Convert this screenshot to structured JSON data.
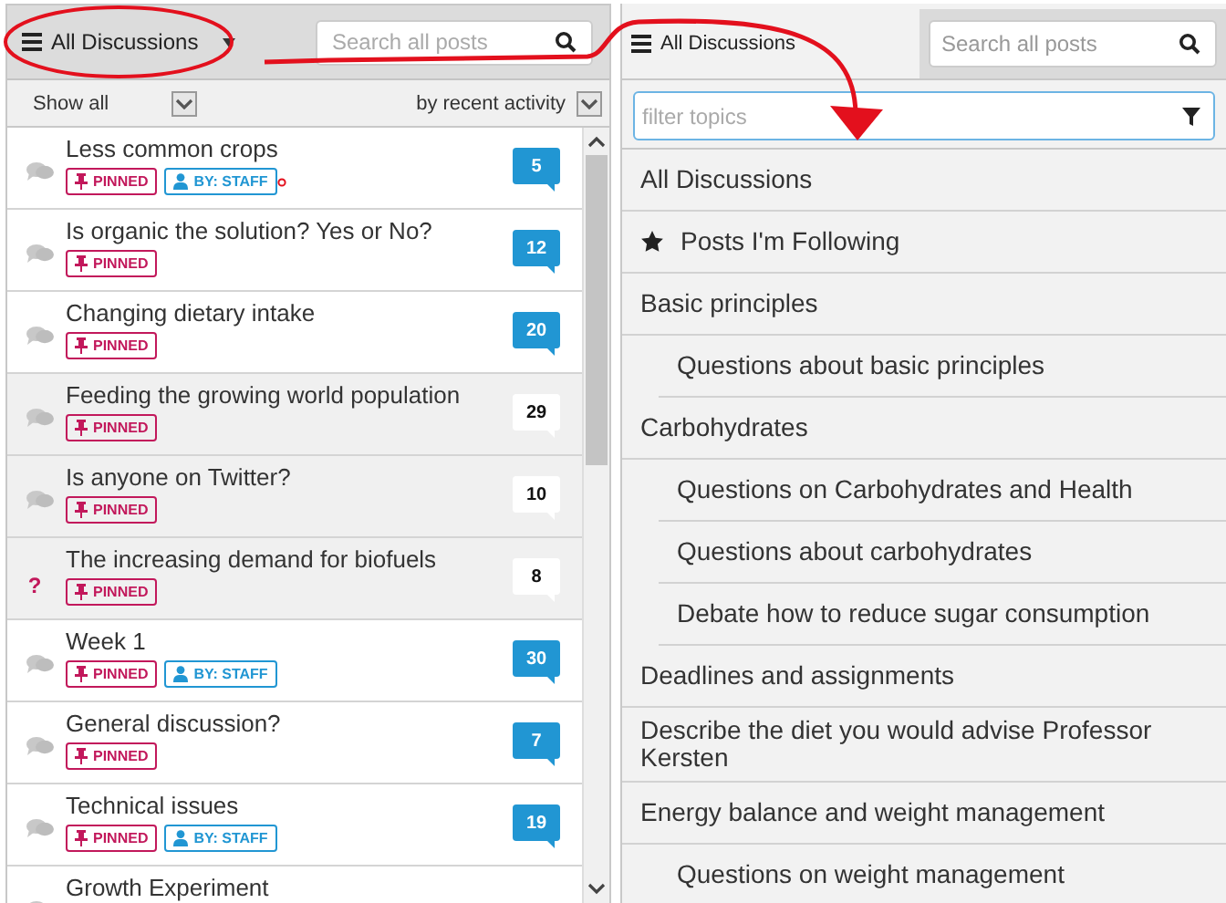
{
  "left_panel": {
    "topic_button": "All Discussions",
    "search": {
      "placeholder": "Search all posts"
    },
    "filter": "Show all",
    "sort": "by recent activity",
    "threads": [
      {
        "kind": "discussion",
        "title": "Less common crops",
        "tags": [
          {
            "kind": "pinned",
            "label": "PINNED"
          },
          {
            "kind": "staff",
            "label": "BY: STAFF"
          }
        ],
        "count": "5",
        "read": false
      },
      {
        "kind": "discussion",
        "title": "Is organic the solution? Yes or No?",
        "tags": [
          {
            "kind": "pinned",
            "label": "PINNED"
          }
        ],
        "count": "12",
        "read": false
      },
      {
        "kind": "discussion",
        "title": "Changing dietary intake",
        "tags": [
          {
            "kind": "pinned",
            "label": "PINNED"
          }
        ],
        "count": "20",
        "read": false
      },
      {
        "kind": "discussion",
        "title": "Feeding the growing world population",
        "tags": [
          {
            "kind": "pinned",
            "label": "PINNED"
          }
        ],
        "count": "29",
        "read": true
      },
      {
        "kind": "discussion",
        "title": "Is anyone on Twitter?",
        "tags": [
          {
            "kind": "pinned",
            "label": "PINNED"
          }
        ],
        "count": "10",
        "read": true
      },
      {
        "kind": "question",
        "icon": "?",
        "title": "The increasing demand for biofuels",
        "tags": [
          {
            "kind": "pinned",
            "label": "PINNED"
          }
        ],
        "count": "8",
        "read": true
      },
      {
        "kind": "discussion",
        "title": "Week 1",
        "tags": [
          {
            "kind": "pinned",
            "label": "PINNED"
          },
          {
            "kind": "staff",
            "label": "BY: STAFF"
          }
        ],
        "count": "30",
        "read": false
      },
      {
        "kind": "discussion",
        "title": "General discussion?",
        "tags": [
          {
            "kind": "pinned",
            "label": "PINNED"
          }
        ],
        "count": "7",
        "read": false
      },
      {
        "kind": "discussion",
        "title": "Technical issues",
        "tags": [
          {
            "kind": "pinned",
            "label": "PINNED"
          },
          {
            "kind": "staff",
            "label": "BY: STAFF"
          }
        ],
        "count": "19",
        "read": false
      },
      {
        "kind": "discussion",
        "title": "Growth Experiment",
        "read": false
      }
    ]
  },
  "right_panel": {
    "topic_button": "All Discussions",
    "search": {
      "placeholder": "Search all posts"
    },
    "filter": {
      "placeholder": "filter topics"
    },
    "topics": [
      {
        "kind": "plain",
        "label": "All Discussions"
      },
      {
        "kind": "following",
        "label": "Posts I'm Following"
      },
      {
        "kind": "plain",
        "label": "Basic principles",
        "children": [
          {
            "kind": "plain",
            "label": "Questions about basic principles"
          }
        ]
      },
      {
        "kind": "plain",
        "label": "Carbohydrates",
        "children": [
          {
            "kind": "plain",
            "label": "Questions on Carbohydrates and Health"
          },
          {
            "kind": "plain",
            "label": "Questions about carbohydrates"
          },
          {
            "kind": "plain",
            "label": "Debate how to reduce sugar consumption"
          }
        ]
      },
      {
        "kind": "plain",
        "label": "Deadlines and assignments"
      },
      {
        "kind": "plain",
        "label": "Describe the diet you would advise Professor Kersten"
      },
      {
        "kind": "plain",
        "label": "Energy balance and weight management",
        "children": [
          {
            "kind": "plain",
            "label": "Questions on weight management"
          }
        ]
      }
    ]
  }
}
